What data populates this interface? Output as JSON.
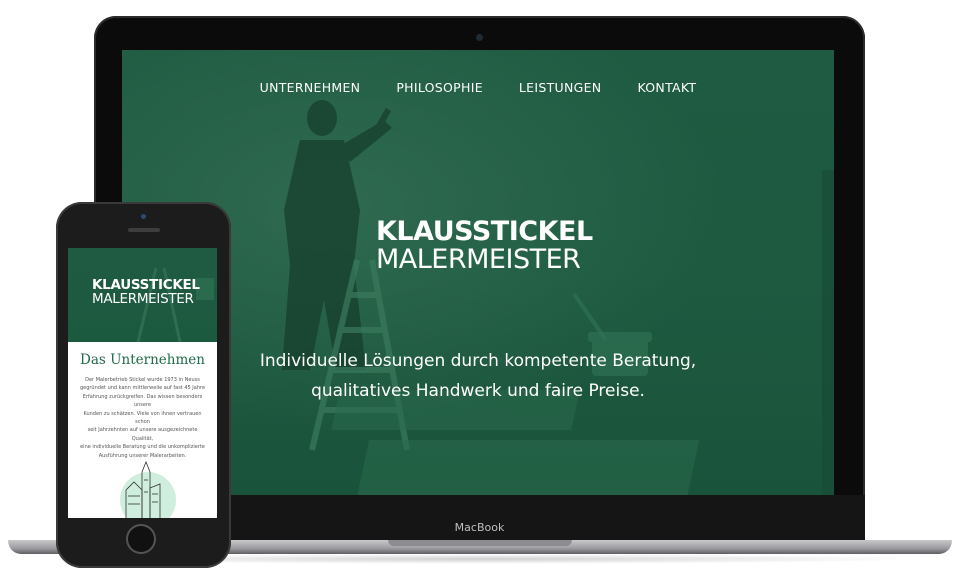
{
  "laptop": {
    "device_label": "MacBook",
    "nav": [
      {
        "label": "UNTERNEHMEN"
      },
      {
        "label": "PHILOSOPHIE"
      },
      {
        "label": "LEISTUNGEN"
      },
      {
        "label": "KONTAKT"
      }
    ],
    "brand": {
      "top": "KLAUSSTICKEL",
      "bottom": "MALERMEISTER"
    },
    "tagline": {
      "line1": "Individuelle Lösungen durch kompetente Beratung,",
      "line2": "qualitatives Handwerk und faire Preise."
    }
  },
  "phone": {
    "brand": {
      "top": "KLAUSSTICKEL",
      "bottom": "MALERMEISTER"
    },
    "heading": "Das Unternehmen",
    "body_lines": [
      "Der Malerbetrieb Stickel wurde 1973 in Neuss",
      "gegründet und kann mittlerweile auf fast 45 Jahre",
      "Erfahrung zurückgreifen. Das wissen besonders unsere",
      "Kunden zu schätzen. Viele von ihnen vertrauen schon",
      "seit Jahrzehnten auf unsere ausgezeichnete Qualität,",
      "eine individuelle Beratung und die unkomplizierte",
      "Ausführung unserer Malerarbeiten."
    ]
  },
  "colors": {
    "brand_green": "#1f5b42",
    "heading_green": "#1f6b4a",
    "illustration_mint": "#cfeedd"
  }
}
